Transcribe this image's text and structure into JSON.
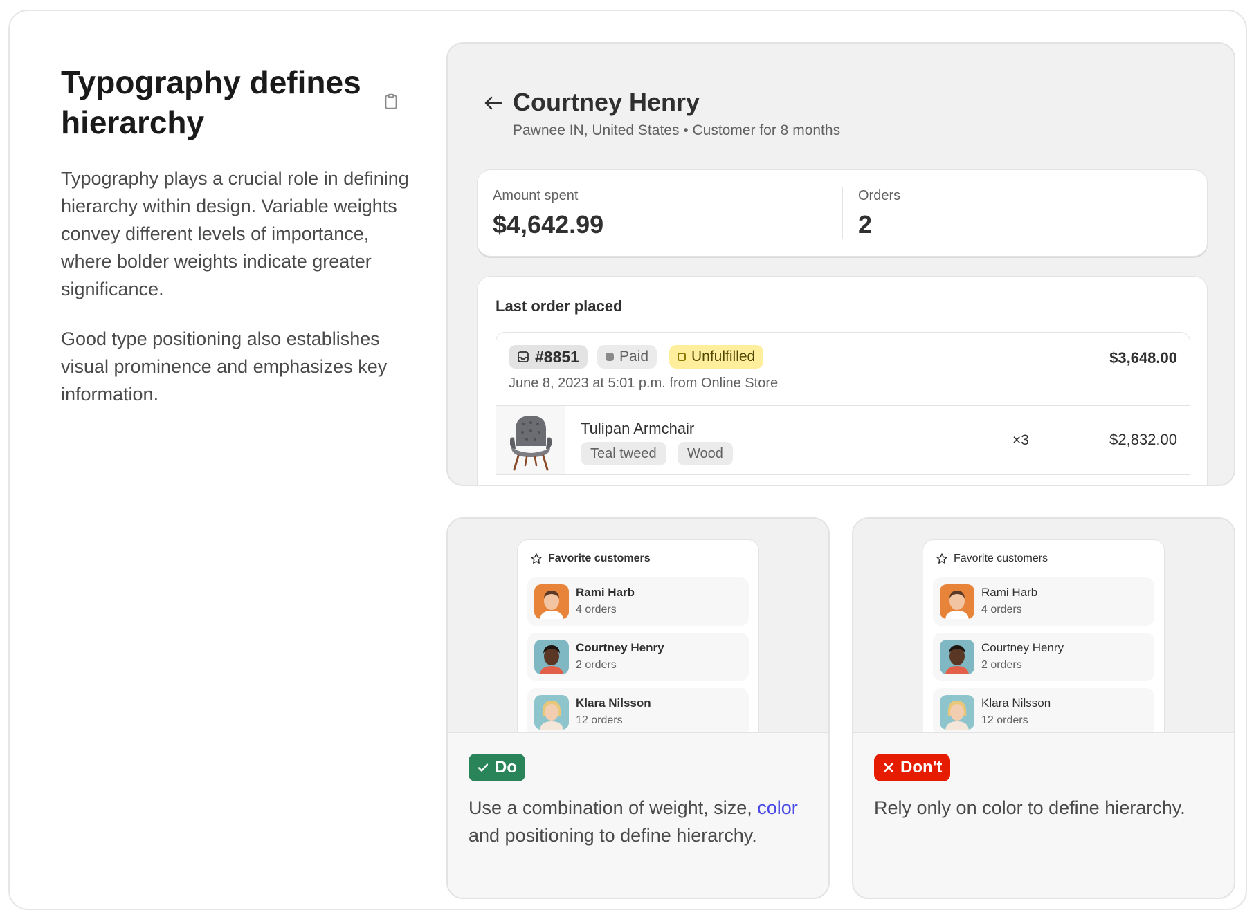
{
  "section": {
    "title": "Typography defines hierarchy",
    "para1": "Typography plays a crucial role in defining hierarchy within design. Variable weights convey different levels of importance, where bolder weights indicate greater significance.",
    "para2": "Good type positioning also establishes visual prominence and emphasizes key information."
  },
  "customer": {
    "name": "Courtney Henry",
    "meta": "Pawnee IN, United States • Customer for 8 months",
    "stats": {
      "amount_label": "Amount spent",
      "amount_value": "$4,642.99",
      "orders_label": "Orders",
      "orders_value": "2"
    },
    "last_order": {
      "heading": "Last order placed",
      "number": "#8851",
      "payment_status": "Paid",
      "fulfillment_status": "Unfulfilled",
      "total": "$3,648.00",
      "date": "June 8, 2023 at 5:01 p.m. from Online Store",
      "item": {
        "name": "Tulipan Armchair",
        "tags": [
          "Teal tweed",
          "Wood"
        ],
        "quantity": "×3",
        "price": "$2,832.00"
      }
    }
  },
  "favorites": {
    "heading": "Favorite customers",
    "customers": [
      {
        "name": "Rami Harb",
        "orders": "4 orders",
        "avatar_bg": "#e8843a"
      },
      {
        "name": "Courtney Henry",
        "orders": "2 orders",
        "avatar_bg": "#7fb8c2"
      },
      {
        "name": "Klara Nilsson",
        "orders": "12 orders",
        "avatar_bg": "#8ec4cc"
      }
    ]
  },
  "do": {
    "badge": "Do",
    "text_before": "Use a combination of weight, size, ",
    "text_link": "color",
    "text_after": " and positioning to define hierarchy."
  },
  "dont": {
    "badge": "Don't",
    "text": "Rely only on color to define hierarchy."
  },
  "colors": {
    "do_green": "#29845a",
    "dont_red": "#e51c00",
    "unfulfilled_yellow": "#ffef9d",
    "link_blue": "#4a4ae6"
  }
}
